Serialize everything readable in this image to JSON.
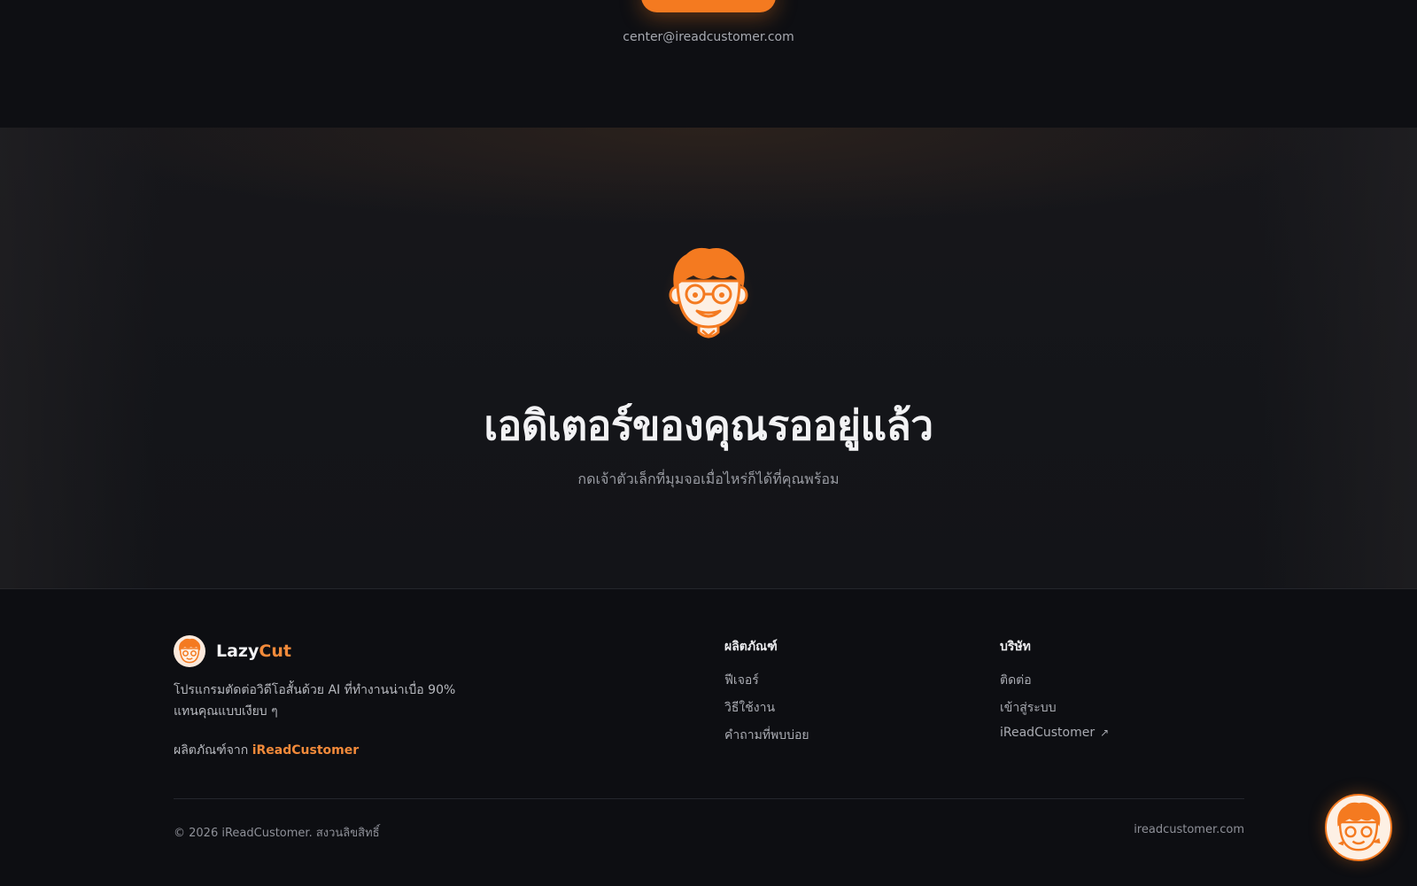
{
  "top": {
    "email": "center@ireadcustomer.com"
  },
  "hero": {
    "title": "เอดิเตอร์ของคุณรออยู่แล้ว",
    "subtitle": "กดเจ้าตัวเล็กที่มุมจอเมื่อไหร่ก็ได้ที่คุณพร้อม",
    "mascot_icon": "mascot-face-icon"
  },
  "footer": {
    "brand": {
      "name_part1": "Lazy",
      "name_part2": "Cut",
      "description": "โปรแกรมตัดต่อวิดีโอสั้นด้วย AI ที่ทำงานน่าเบื่อ 90% แทนคุณแบบเงียบ ๆ",
      "by_label": "ผลิตภัณฑ์จาก",
      "by_link": "iReadCustomer"
    },
    "columns": [
      {
        "title": "ผลิตภัณฑ์",
        "links": [
          "ฟีเจอร์",
          "วิธีใช้งาน",
          "คำถามที่พบบ่อย"
        ]
      },
      {
        "title": "บริษัท",
        "links": [
          "ติดต่อ",
          "เข้าสู่ระบบ",
          "iReadCustomer"
        ]
      }
    ],
    "external_icon": "↗",
    "copyright": "© 2026 iReadCustomer. สงวนลิขสิทธิ์",
    "site_url": "ireadcustomer.com"
  },
  "colors": {
    "accent": "#f47a20",
    "background": "#0d0e12",
    "text": "#e8e8ea",
    "muted": "#9a9ca3"
  }
}
